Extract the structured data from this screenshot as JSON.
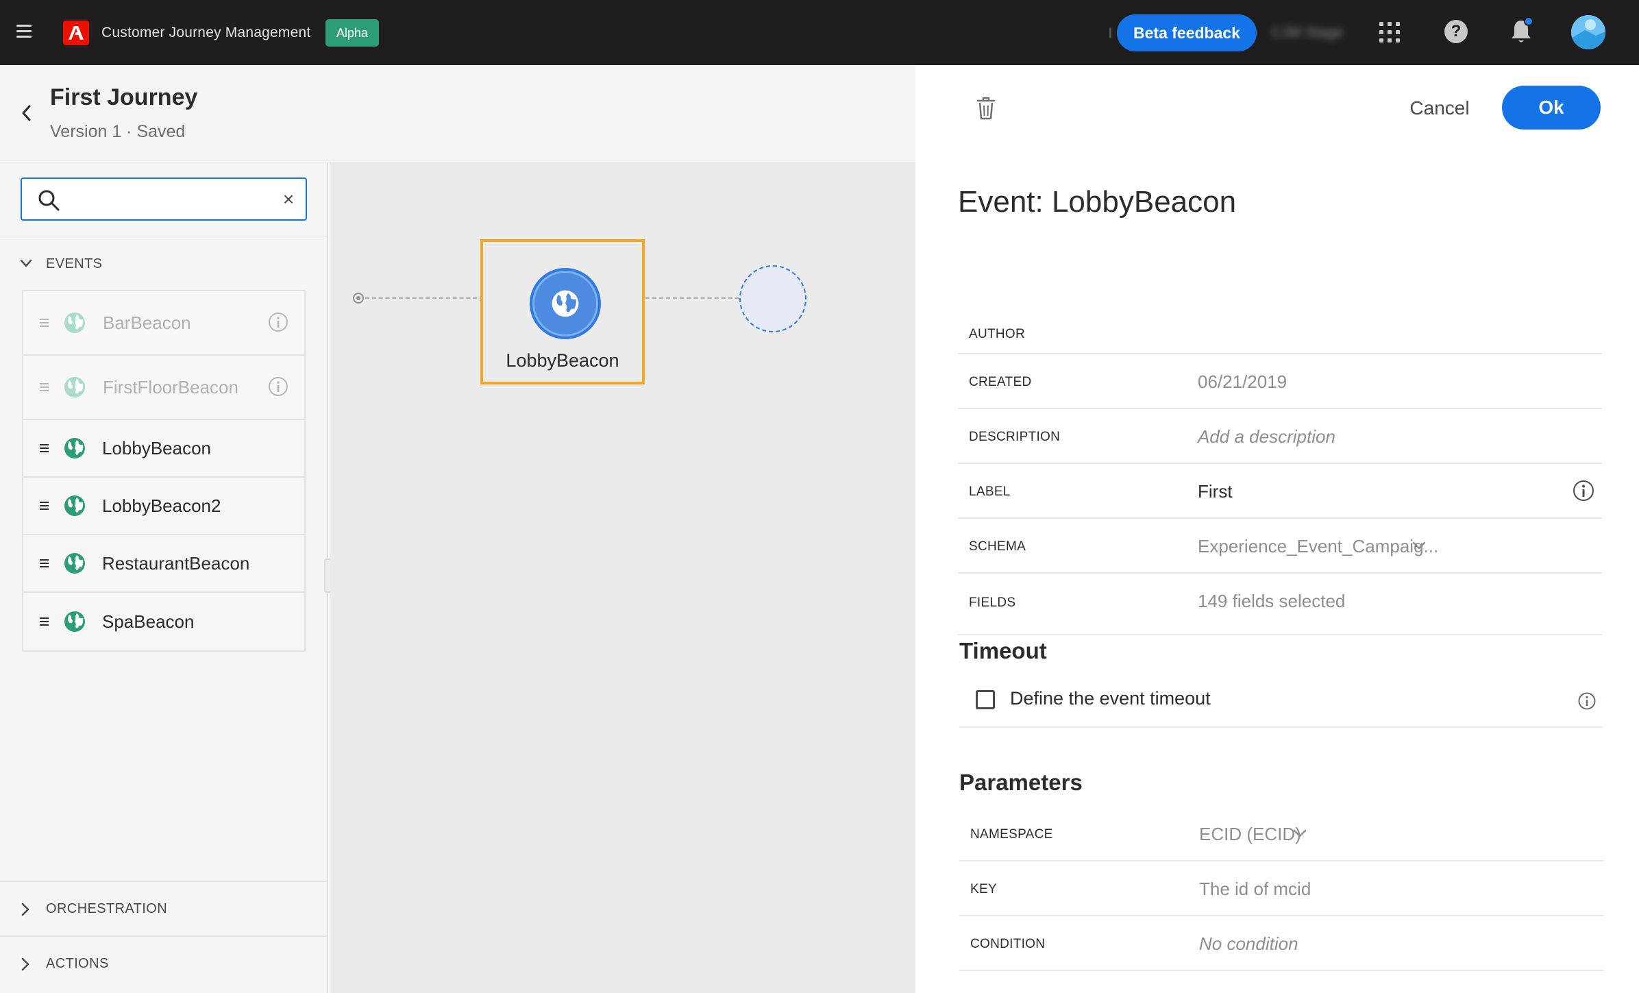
{
  "topbar": {
    "app_title": "Customer Journey Management",
    "badge": "Alpha",
    "beta_feedback": "Beta feedback",
    "org_name": "CJM Stage",
    "icons": [
      "menu-icon",
      "adobe-logo",
      "apps-grid-icon",
      "help-icon",
      "notification-bell-icon",
      "user-avatar"
    ]
  },
  "journey": {
    "title": "First Journey",
    "version": "Version 1 · Saved"
  },
  "left_panel": {
    "search": {
      "value": "",
      "placeholder": ""
    },
    "events_label": "EVENTS",
    "events": [
      {
        "name": "BarBeacon",
        "state": "disabled"
      },
      {
        "name": "FirstFloorBeacon",
        "state": "disabled"
      },
      {
        "name": "LobbyBeacon",
        "state": "enabled"
      },
      {
        "name": "LobbyBeacon2",
        "state": "enabled"
      },
      {
        "name": "RestaurantBeacon",
        "state": "enabled"
      },
      {
        "name": "SpaBeacon",
        "state": "enabled"
      }
    ],
    "orchestration_label": "ORCHESTRATION",
    "actions_label": "ACTIONS"
  },
  "canvas": {
    "node_label": "LobbyBeacon"
  },
  "right_panel": {
    "cancel": "Cancel",
    "ok": "Ok",
    "title": "Event: LobbyBeacon",
    "properties": {
      "author": {
        "label": "AUTHOR",
        "value": ""
      },
      "created": {
        "label": "CREATED",
        "value": "06/21/2019"
      },
      "description": {
        "label": "DESCRIPTION",
        "value": "Add a description"
      },
      "label": {
        "label": "LABEL",
        "value": "First"
      },
      "schema": {
        "label": "SCHEMA",
        "value": "Experience_Event_Campaig..."
      },
      "fields": {
        "label": "FIELDS",
        "value": "149 fields selected"
      }
    },
    "timeout": {
      "title": "Timeout",
      "checkbox_label": "Define the event timeout",
      "checked": false
    },
    "parameters": {
      "title": "Parameters",
      "namespace": {
        "label": "NAMESPACE",
        "value": "ECID (ECID)"
      },
      "key": {
        "label": "KEY",
        "value": "The id of mcid"
      },
      "condition": {
        "label": "CONDITION",
        "value": "No condition"
      }
    }
  },
  "colors": {
    "accent_blue": "#1473e6",
    "alpha_green": "#2d9d78",
    "selection_orange": "#f5a623",
    "event_globe_green": "#2d9d78",
    "topbar_bg": "#1e1e1e"
  }
}
